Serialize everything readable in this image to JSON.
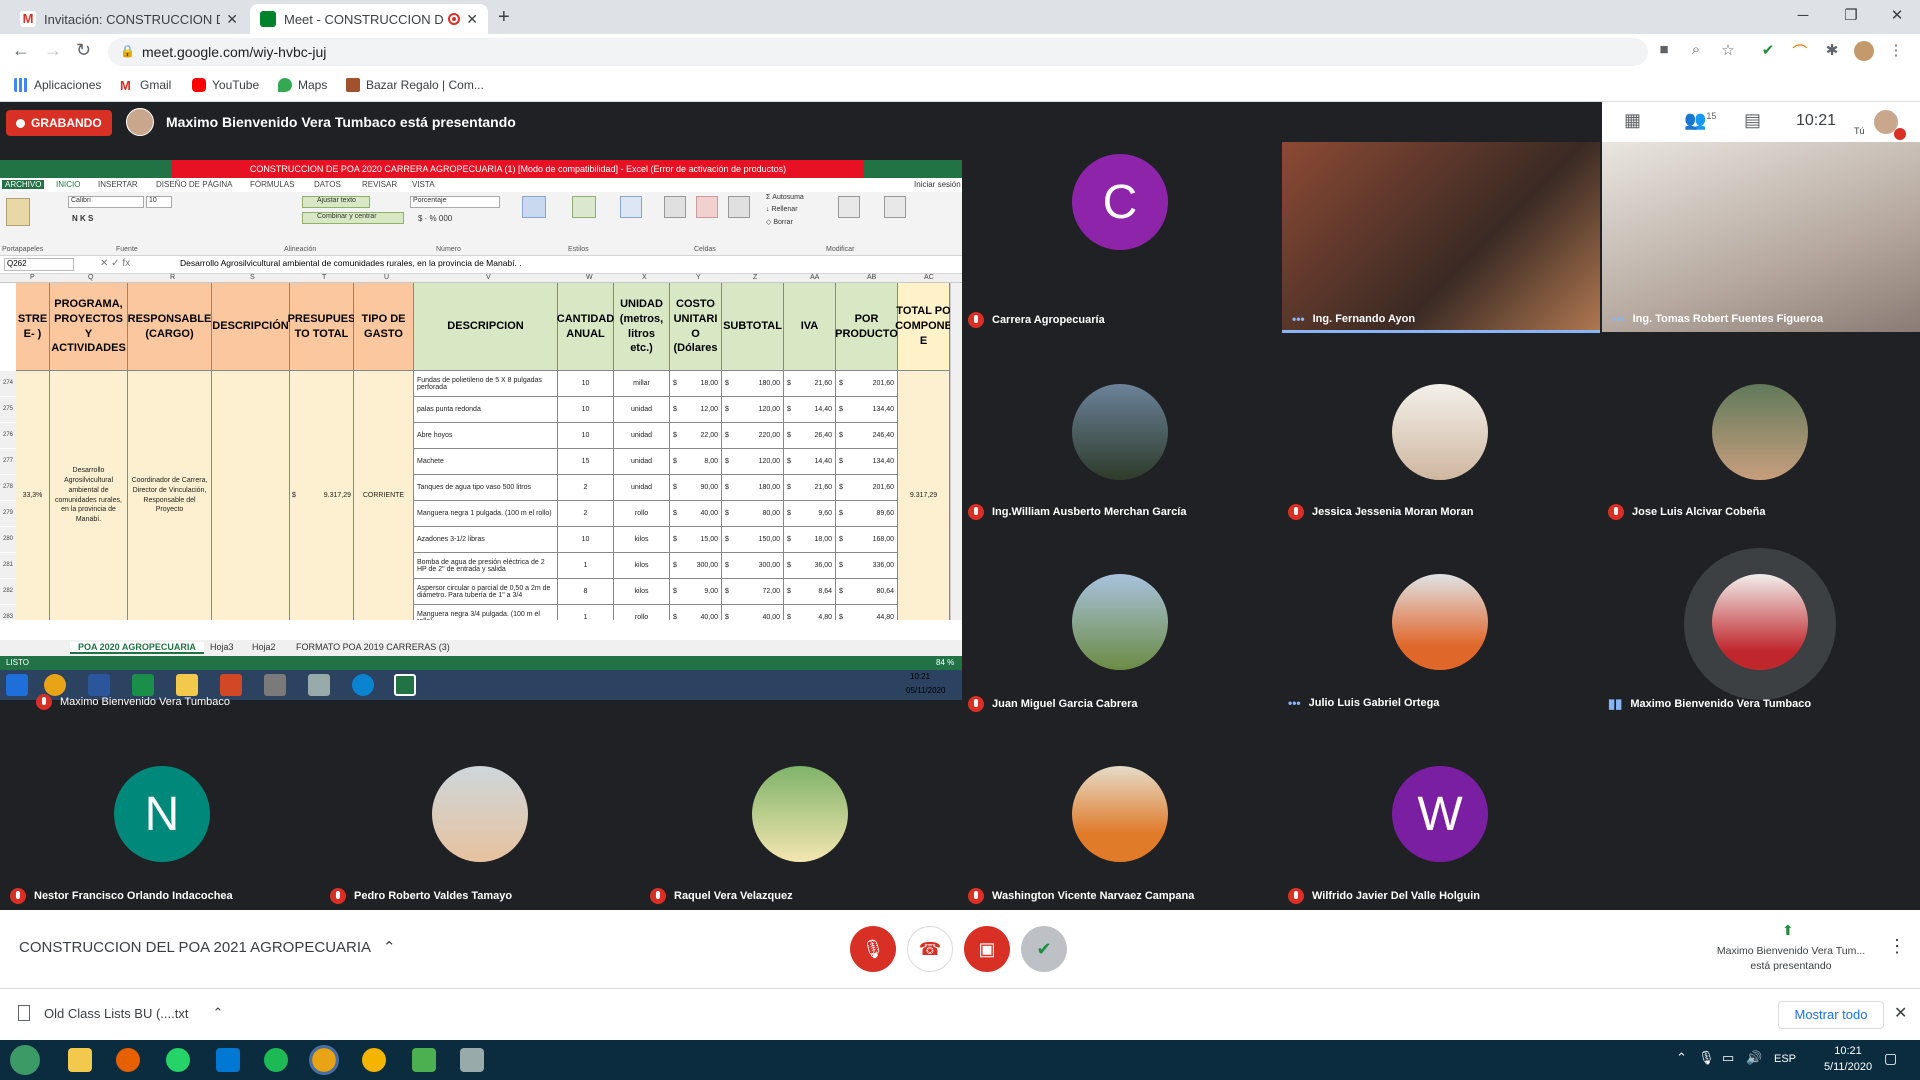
{
  "browser": {
    "tabs": [
      {
        "title": "Invitación: CONSTRUCCION DEL"
      },
      {
        "title": "Meet - CONSTRUCCION DEL"
      }
    ],
    "url": "meet.google.com/wiy-hvbc-juj",
    "bookmarks": [
      "Aplicaciones",
      "Gmail",
      "YouTube",
      "Maps",
      "Bazar Regalo | Com..."
    ]
  },
  "meet": {
    "recording_label": "GRABANDO",
    "presenter_text": "Maximo Bienvenido Vera Tumbaco está presentando",
    "people_count": "15",
    "clock": "10:21",
    "self_label": "Tú",
    "shared_owner": "Maximo Bienvenido Vera Tumbaco",
    "participants": [
      {
        "name": "Carrera Agropecuaría",
        "initial": "C",
        "color": "#8e24aa"
      },
      {
        "name": "Ing. Fernando Ayon"
      },
      {
        "name": "Ing. Tomas Robert Fuentes Figueroa"
      },
      {
        "name": "Ing.William Ausberto Merchan García"
      },
      {
        "name": "Jessica Jessenia Moran Moran"
      },
      {
        "name": "Jose Luis Alcivar Cobeña"
      },
      {
        "name": "Juan Miguel Garcia Cabrera"
      },
      {
        "name": "Julio Luis Gabriel Ortega"
      },
      {
        "name": "Maximo Bienvenido Vera Tumbaco"
      },
      {
        "name": "Nestor Francisco Orlando Indacochea",
        "initial": "N",
        "color": "#00897b"
      },
      {
        "name": "Pedro Roberto Valdes Tamayo"
      },
      {
        "name": "Raquel Vera Velazquez"
      },
      {
        "name": "Washington Vicente Narvaez Campana"
      },
      {
        "name": "Wilfrido Javier Del Valle Holguin",
        "initial": "W",
        "color": "#7b1fa2"
      }
    ],
    "meeting_title": "CONSTRUCCION DEL POA 2021 AGROPECUARIA",
    "presenting_note_1": "Maximo Bienvenido Vera Tum...",
    "presenting_note_2": "está presentando"
  },
  "excel": {
    "title": "CONSTRUCCION DE POA 2020 CARRERA AGROPECUARIA (1) [Modo de compatibilidad] - Excel (Error de activación de productos)",
    "ribbon_tabs": [
      "ARCHIVO",
      "INICIO",
      "INSERTAR",
      "DISEÑO DE PÁGINA",
      "FÓRMULAS",
      "DATOS",
      "REVISAR",
      "VISTA"
    ],
    "sign_in": "Iniciar sesión",
    "font": "Calibri",
    "size": "10",
    "number_format": "Porcentaje",
    "wrap": "Ajustar texto",
    "merge": "Combinar y centrar",
    "groups": [
      "Portapapeles",
      "Fuente",
      "Alineación",
      "Número",
      "Estilos",
      "Celdas",
      "Modificar"
    ],
    "autosum": "Autosuma",
    "fill": "Rellenar",
    "clear": "Borrar",
    "cell_ref": "Q262",
    "formula": "Desarrollo Agrosilvicultural ambiental de comunidades rurales, en la provincia de Manabí. .",
    "columns": [
      "P",
      "Q",
      "R",
      "S",
      "T",
      "U",
      "V",
      "W",
      "X",
      "Y",
      "Z",
      "AA",
      "AB",
      "AC"
    ],
    "headers": {
      "p": "STRE E- )",
      "q": "PROGRAMA, PROYECTOS Y ACTIVIDADES",
      "r": "RESPONSABLE (CARGO)",
      "s": "DESCRIPCIÓN",
      "t": "PRESUPUES TO TOTAL",
      "u": "TIPO DE GASTO",
      "v": "DESCRIPCION",
      "w": "CANTIDAD ANUAL",
      "x": "UNIDAD (metros, litros etc.)",
      "y": "COSTO UNITARI O (Dólares",
      "z": "SUBTOTAL",
      "aa": "IVA",
      "ab": "POR PRODUCTO",
      "ac": "TOTAL PO COMPONE E"
    },
    "merged": {
      "p": "33,3%",
      "q": "Desarrollo Agrosilvicultural ambiental de comunidades rurales, en la provincia de Manabí.",
      "r": "Coordinador de Carrera, Director de Vinculación, Responsable del Proyecto",
      "t_sym": "$",
      "t": "9.317,29",
      "u": "CORRIENTE",
      "ac": "9.317,29"
    },
    "rows": [
      {
        "n": "274",
        "desc": "Fundas de polietileno de 5 X 8 pulgadas perforada",
        "qty": "10",
        "unit": "millar",
        "cost": "18,00",
        "sub": "180,00",
        "iva": "21,60",
        "prod": "201,60"
      },
      {
        "n": "275",
        "desc": "palas punta redonda",
        "qty": "10",
        "unit": "unidad",
        "cost": "12,00",
        "sub": "120,00",
        "iva": "14,40",
        "prod": "134,40"
      },
      {
        "n": "276",
        "desc": "Abre hoyos",
        "qty": "10",
        "unit": "unidad",
        "cost": "22,00",
        "sub": "220,00",
        "iva": "26,40",
        "prod": "246,40"
      },
      {
        "n": "277",
        "desc": "Machete",
        "qty": "15",
        "unit": "unidad",
        "cost": "8,00",
        "sub": "120,00",
        "iva": "14,40",
        "prod": "134,40"
      },
      {
        "n": "278",
        "desc": "Tanques de agua tipo vaso 500 litros",
        "qty": "2",
        "unit": "unidad",
        "cost": "90,00",
        "sub": "180,00",
        "iva": "21,60",
        "prod": "201,60"
      },
      {
        "n": "279",
        "desc": "Manguera negra 1 pulgada. (100 m el rollo)",
        "qty": "2",
        "unit": "rollo",
        "cost": "40,00",
        "sub": "80,00",
        "iva": "9,60",
        "prod": "89,60"
      },
      {
        "n": "280",
        "desc": "Azadones 3-1/2 libras",
        "qty": "10",
        "unit": "kilos",
        "cost": "15,00",
        "sub": "150,00",
        "iva": "18,00",
        "prod": "168,00"
      },
      {
        "n": "281",
        "desc": "Bomba de agua de presión eléctrica de 2 HP de 2\" de entrada y salida",
        "qty": "1",
        "unit": "kilos",
        "cost": "300,00",
        "sub": "300,00",
        "iva": "36,00",
        "prod": "336,00"
      },
      {
        "n": "282",
        "desc": "Aspersor circular o parcial de 0,50 a 2m de diámetro. Para tubería de 1\" a 3/4",
        "qty": "8",
        "unit": "kilos",
        "cost": "9,00",
        "sub": "72,00",
        "iva": "8,64",
        "prod": "80,64"
      },
      {
        "n": "283",
        "desc": "Manguera negra 3/4 pulgada. (100 m el rollo)",
        "qty": "1",
        "unit": "rollo",
        "cost": "40,00",
        "sub": "40,00",
        "iva": "4,80",
        "prod": "44,80"
      }
    ],
    "currency": "$",
    "sheets": [
      "POA 2020 AGROPECUARIA",
      "Hoja3",
      "Hoja2",
      "FORMATO POA 2019 CARRERAS (3)"
    ],
    "status": "LISTO",
    "zoom": "84 %",
    "inner_time": "10:21",
    "inner_date": "05/11/2020"
  },
  "download": {
    "file": "Old Class Lists BU (....txt",
    "show_all": "Mostrar todo"
  },
  "windows": {
    "lang": "ESP",
    "time": "10:21",
    "date": "5/11/2020"
  }
}
